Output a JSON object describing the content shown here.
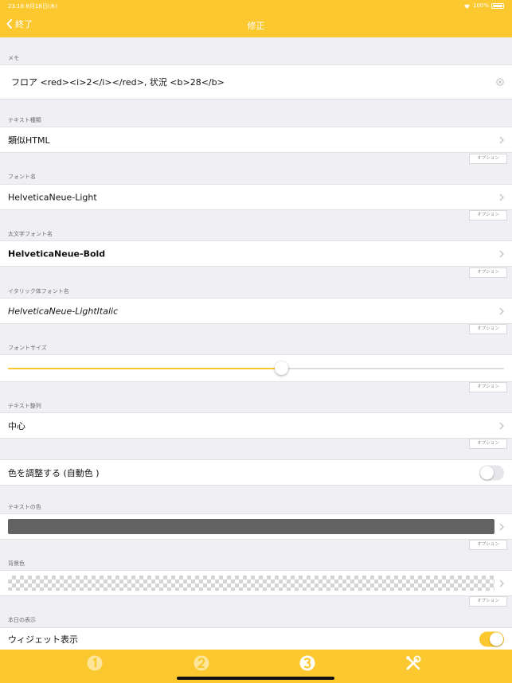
{
  "status": {
    "time_date": "23:16 8月18日(木)",
    "battery": "100%"
  },
  "nav": {
    "back_label": "終了",
    "title": "修正"
  },
  "memo": {
    "label": "メモ",
    "value": "フロア <red><i>2</i></red>, 状況 <b>28</b>"
  },
  "text_type": {
    "label": "テキスト種類",
    "value": "類似HTML"
  },
  "font_name": {
    "label": "フォント名",
    "value": "HelveticaNeue-Light"
  },
  "bold_font": {
    "label": "太文字フォント名",
    "value": "HelveticaNeue-Bold"
  },
  "italic_font": {
    "label": "イタリック体フォント名",
    "value": "HelveticaNeue-LightItalic"
  },
  "font_size": {
    "label": "フォントサイズ",
    "slider_fraction": 0.55
  },
  "alignment": {
    "label": "テキスト整列",
    "value": "中心"
  },
  "auto_color": {
    "label": "色を調整する (自動色 )",
    "on": false
  },
  "text_color": {
    "label": "テキストの色",
    "swatch": "#626262"
  },
  "bg_color": {
    "label": "背景色",
    "swatch": "transparent-checker"
  },
  "today": {
    "label": "本日の表示"
  },
  "widget": {
    "label": "ウィジェット表示",
    "on": true
  },
  "option_label": "オプション",
  "colors": {
    "accent": "#fcc830",
    "toggle_off": "#e5e5ea"
  },
  "tabs": [
    {
      "icon": "circled-one-icon"
    },
    {
      "icon": "circled-two-icon"
    },
    {
      "icon": "circled-three-icon",
      "selected": true
    },
    {
      "icon": "tools-icon"
    }
  ]
}
